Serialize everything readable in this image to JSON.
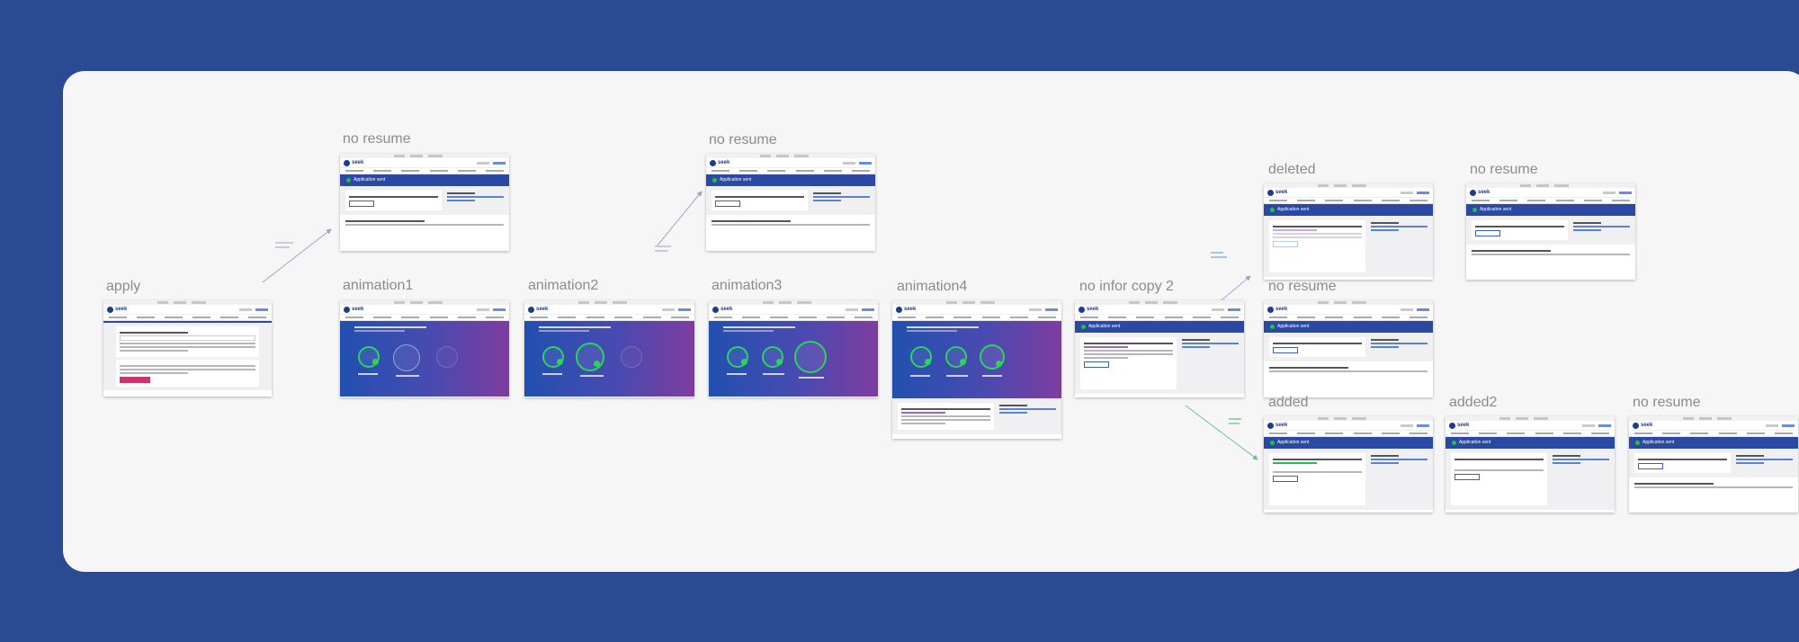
{
  "board": {
    "labels": {
      "apply": "apply",
      "no_resume_1": "no resume",
      "animation1": "animation1",
      "animation2": "animation2",
      "no_resume_2": "no resume",
      "animation3": "animation3",
      "animation4": "animation4",
      "no_infor_copy_2": "no infor copy 2",
      "deleted": "deleted",
      "no_resume_3": "no resume",
      "no_resume_4": "no resume",
      "added": "added",
      "added2": "added2",
      "no_resume_5": "no resume"
    },
    "mini_app": {
      "brand": "seek",
      "banner_text": "Application sent"
    },
    "colors": {
      "background": "#2a4a93",
      "board": "#f6f6f7",
      "banner": "#2b49a3",
      "success": "#23c04d",
      "apply_button": "#e0276f"
    },
    "icons": [
      "seek-logo-icon",
      "checkmark-icon",
      "resume-icon",
      "update-icon"
    ]
  }
}
